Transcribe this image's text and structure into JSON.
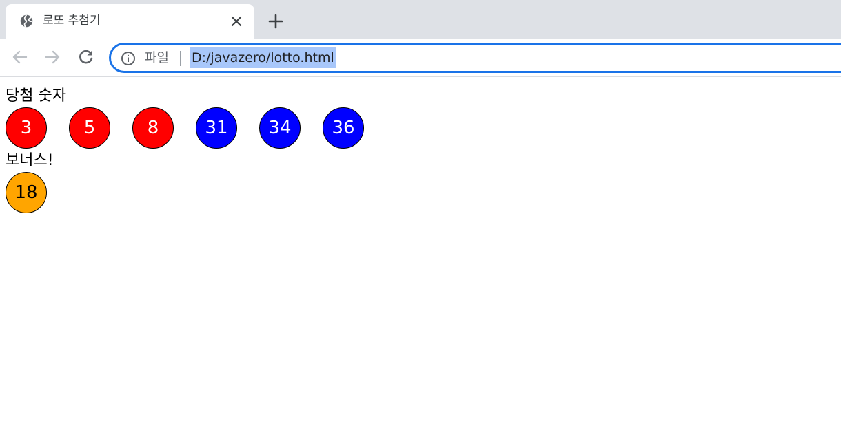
{
  "browser": {
    "tab": {
      "title": "로또 추첨기",
      "favicon": "globe-icon",
      "close_icon": "close-icon"
    },
    "new_tab_icon": "plus-icon",
    "toolbar": {
      "back_icon": "back-arrow-icon",
      "forward_icon": "forward-arrow-icon",
      "reload_icon": "reload-icon"
    },
    "address_bar": {
      "info_icon": "info-icon",
      "scheme_label": "파일",
      "url": "D:/javazero/lotto.html",
      "url_selected": true
    }
  },
  "page": {
    "winning_label": "당첨 숫자",
    "winning_numbers": [
      {
        "number": "3",
        "color": "#ff0000",
        "text_color": "#ffffff"
      },
      {
        "number": "5",
        "color": "#ff0000",
        "text_color": "#ffffff"
      },
      {
        "number": "8",
        "color": "#ff0000",
        "text_color": "#ffffff"
      },
      {
        "number": "31",
        "color": "#0000ff",
        "text_color": "#ffffff"
      },
      {
        "number": "34",
        "color": "#0000ff",
        "text_color": "#ffffff"
      },
      {
        "number": "36",
        "color": "#0000ff",
        "text_color": "#ffffff"
      }
    ],
    "bonus_label": "보너스!",
    "bonus_number": {
      "number": "18",
      "color": "#ffa500",
      "text_color": "#000000"
    }
  },
  "colors": {
    "tabstrip_bg": "#dee1e6",
    "accent": "#1a73e8",
    "selection": "#a8c7fa"
  }
}
